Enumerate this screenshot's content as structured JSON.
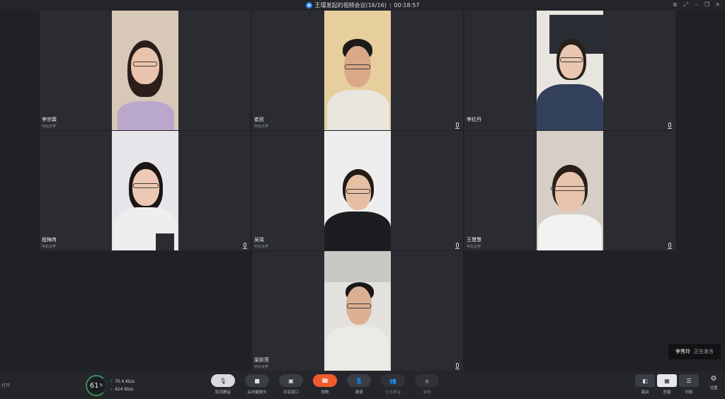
{
  "window": {
    "title": "王瑾发起的视频会议(16/16)",
    "separator": "|",
    "timer": "00:18:57"
  },
  "participants": [
    {
      "name": "李宗霖",
      "org": "中北大学",
      "bg": "#d7c8b7",
      "shirt": "#b9a7cc",
      "hair": "#2a1e1a",
      "skin": "#e9c3ab"
    },
    {
      "name": "崔凯",
      "org": "中北大学",
      "bg": "#e6cf9d",
      "shirt": "#e9e5df",
      "hair": "#1d1a18",
      "skin": "#d9a987"
    },
    {
      "name": "李红丹",
      "org": "",
      "bg": "#e8e5e0",
      "shirt": "#33405c",
      "hair": "#2a1f1a",
      "skin": "#eac7b0"
    },
    {
      "name": "程梅冉",
      "org": "中北大学",
      "bg": "#e6e6ea",
      "shirt": "#eeeeee",
      "hair": "#1c1614",
      "skin": "#edc9b5"
    },
    {
      "name": "吴瑶",
      "org": "中北大学",
      "bg": "#eeeeee",
      "shirt": "#1b1d20",
      "hair": "#231915",
      "skin": "#e6bea4"
    },
    {
      "name": "王慧慧",
      "org": "中北大学",
      "bg": "#d7cfc6",
      "shirt": "#f2f2f2",
      "hair": "#2a1e18",
      "skin": "#e9c4ad"
    },
    {
      "name": "梁彩亮",
      "org": "中北大学",
      "bg": "#e4e2de",
      "shirt": "#eceae6",
      "hair": "#1b1715",
      "skin": "#dcb093"
    }
  ],
  "speaking": {
    "who": "李秀玲",
    "status": "正在发言"
  },
  "toolbar": {
    "side_label": "打开",
    "network": {
      "score": "61",
      "unit": "%",
      "up": "70.4",
      "up_unit": "Kb/s",
      "down": "424",
      "down_unit": "Kb/s"
    },
    "buttons": [
      {
        "label": "取消静音",
        "icon": "mic-icon"
      },
      {
        "label": "关闭摄像头",
        "icon": "camera-icon"
      },
      {
        "label": "共享窗口",
        "icon": "share-icon"
      },
      {
        "label": "挂断",
        "icon": "hangup-icon"
      },
      {
        "label": "邀请",
        "icon": "invite-icon"
      },
      {
        "label": "全员静音",
        "icon": "mute-all-icon"
      },
      {
        "label": "录制",
        "icon": "record-icon"
      }
    ],
    "views": [
      {
        "label": "演讲",
        "icon": "speaker-view-icon"
      },
      {
        "label": "宫格",
        "icon": "grid-view-icon"
      },
      {
        "label": "列表",
        "icon": "list-view-icon"
      }
    ],
    "settings_label": "设置"
  }
}
